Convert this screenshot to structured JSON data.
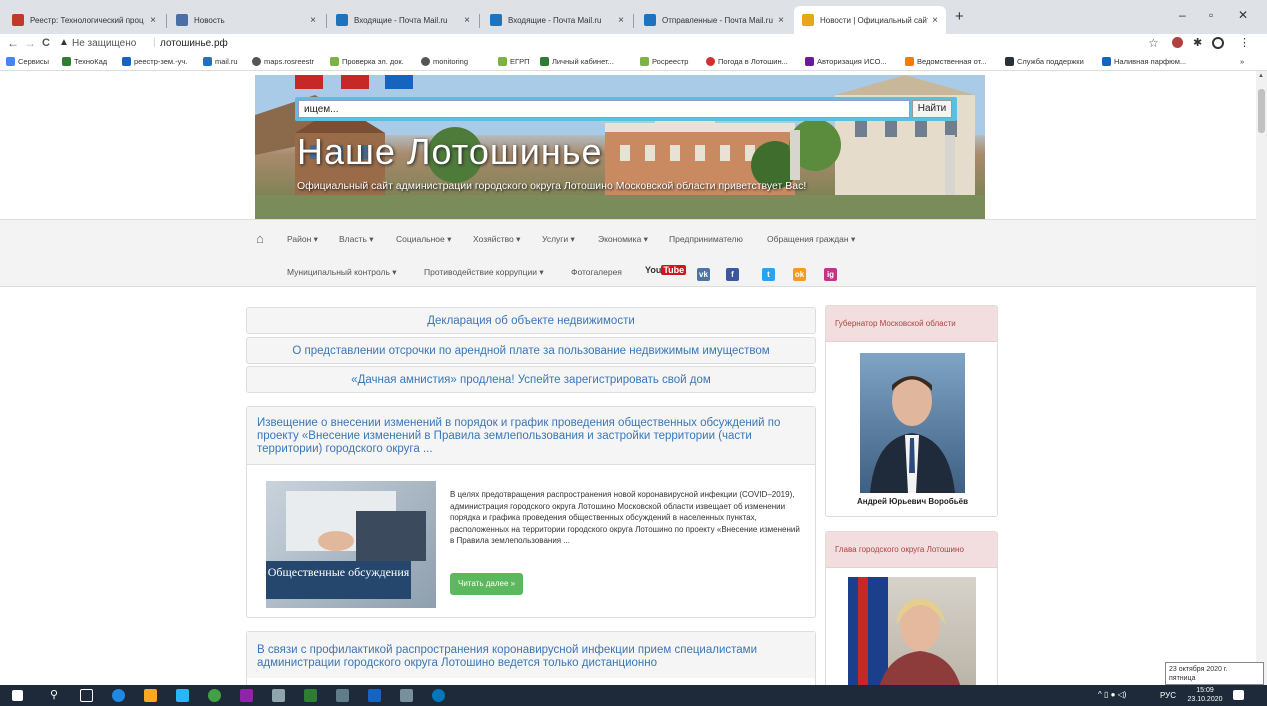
{
  "browser": {
    "tabs": [
      {
        "title": "Реестр: Технологический проц",
        "color": "#c0392b",
        "close": "×"
      },
      {
        "title": "Новость",
        "color": "#4a6fa5",
        "close": "×"
      },
      {
        "title": "Входящие - Почта Mail.ru",
        "color": "#1e73be",
        "close": "×"
      },
      {
        "title": "Входящие - Почта Mail.ru",
        "color": "#1e73be",
        "close": "×"
      },
      {
        "title": "Отправленные - Почта Mail.ru",
        "color": "#1e73be",
        "close": "×"
      },
      {
        "title": "Новости | Официальный сайт а",
        "color": "#e6a817",
        "close": "×"
      }
    ],
    "new_tab": "+",
    "window_controls": [
      "–",
      "▫",
      "✕"
    ],
    "nav_back": "←",
    "nav_forward": "→",
    "reload": "C",
    "insecure_label": "Не защищено",
    "url": "лотошинье.рф",
    "bookmarks": [
      {
        "label": "Сервисы",
        "color": "#4285f4"
      },
      {
        "label": "ТехноКад",
        "color": "#2e7d32"
      },
      {
        "label": "реестр-зем.-уч.",
        "color": "#1565c0"
      },
      {
        "label": "mail.ru",
        "color": "#1e73be"
      },
      {
        "label": "maps.rosreestr",
        "color": "#555555"
      },
      {
        "label": "Проверка эл. док.",
        "color": "#7cb342"
      },
      {
        "label": "monitoring",
        "color": "#555555"
      },
      {
        "label": "ЕГРП",
        "color": "#7cb342"
      },
      {
        "label": "Личный кабинет...",
        "color": "#2e7d32"
      },
      {
        "label": "Росреестр",
        "color": "#7cb342"
      },
      {
        "label": "Погода в Лотошин...",
        "color": "#d32f2f"
      },
      {
        "label": "Авторизация ИСО...",
        "color": "#6a1b9a"
      },
      {
        "label": "Ведомственная от...",
        "color": "#f57c00"
      },
      {
        "label": "Служба поддержки",
        "color": "#263238"
      },
      {
        "label": "Наливная парфюм...",
        "color": "#1565c0"
      }
    ],
    "more_bookmarks": "»"
  },
  "site": {
    "search_placeholder": "ищем...",
    "search_button": "Найти",
    "title": "Наше Лотошинье",
    "subtitle": "Официальный сайт администрации городского округа Лотошино Московской области приветствует Вас!",
    "nav_row1": [
      "Район ▾",
      "Власть ▾",
      "Социальное ▾",
      "Хозяйство ▾",
      "Услуги ▾",
      "Экономика ▾",
      "Предпринимателю",
      "Обращения граждан ▾"
    ],
    "nav_row2": [
      "Муниципальный контроль ▾",
      "Противодействие коррупции ▾",
      "Фотогалерея"
    ],
    "social": [
      {
        "label": "You",
        "label2": "Tube",
        "color": "#cc181e"
      },
      {
        "label": "vk",
        "color": "#4c75a3"
      },
      {
        "label": "f",
        "color": "#3b5998"
      },
      {
        "label": "t",
        "color": "#2aa3ef"
      },
      {
        "label": "ok",
        "color": "#f59a23"
      },
      {
        "label": "ig",
        "color": "#c13584"
      }
    ],
    "top_links": [
      "Декларация об объекте недвижимости",
      "О представлении отсрочки по арендной плате за пользование недвижимым имуществом",
      "«Дачная амнистия» продлена! Успейте зарегистрировать свой дом"
    ],
    "article1": {
      "title": "Извещение о внесении изменений в порядок и график проведения общественных обсуждений по проекту «Внесение изменений в Правила землепользования и застройки территории (части территории) городского округа ...",
      "image_caption": "Общественные обсуждения",
      "body": "В целях предотвращения распространения новой коронавирусной инфекции (COVID–2019), администрация городского округа Лотошино Московской области извещает об изменении порядка и графика проведения общественных обсуждений в населенных пунктах, расположенных на территории городского округа Лотошино по проекту «Внесение изменений в Правила землепользования ...",
      "read_more": "Читать далее »"
    },
    "article2": {
      "title": "В связи с профилактикой распространения коронавирусной инфекции прием специалистами администрации городского округа Лотошино ведется только дистанционно"
    },
    "sidebar": {
      "governor_heading": "Губернатор Московской области",
      "governor_name": "Андрей Юрьевич Воробьёв",
      "head_heading": "Глава городского округа Лотошино"
    }
  },
  "taskbar": {
    "lang": "РУС",
    "time": "15:09",
    "date": "23.10.2020",
    "tooltip_date": "23 октября 2020 г.",
    "tooltip_day": "пятница"
  }
}
